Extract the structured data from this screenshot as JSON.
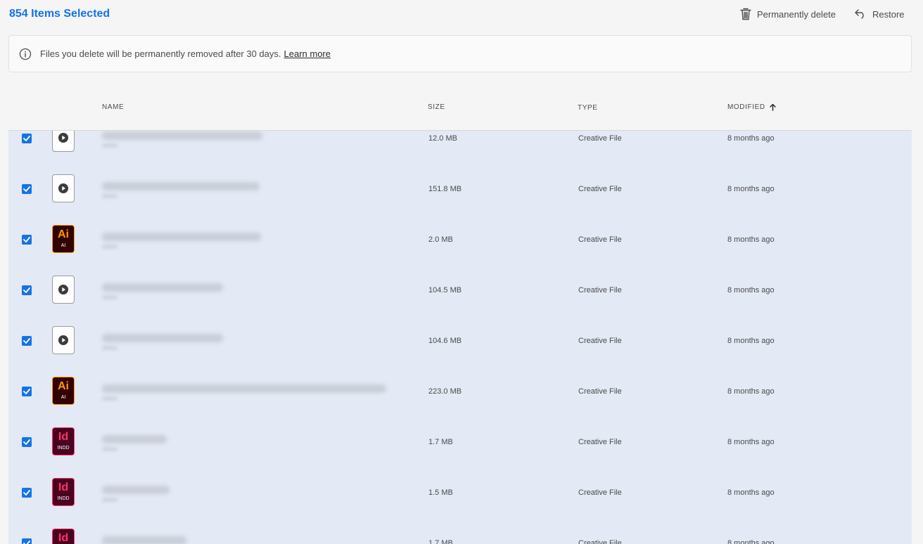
{
  "header": {
    "selection_title": "854 Items Selected",
    "permanently_delete_label": "Permanently delete",
    "restore_label": "Restore",
    "delete_icon": "trash-icon",
    "restore_icon": "undo-icon"
  },
  "banner": {
    "icon": "info-icon",
    "message": "Files you delete will be permanently removed after 30 days.",
    "link_label": "Learn more"
  },
  "table": {
    "columns": {
      "name": "NAME",
      "size": "SIZE",
      "type": "TYPE",
      "modified": "MODIFIED"
    },
    "sort": {
      "column": "modified",
      "direction": "ascending",
      "icon": "arrow-up-icon"
    },
    "rows": [
      {
        "selected": true,
        "icon": "video",
        "size": "12.0 MB",
        "type": "Creative File",
        "modified": "8 months ago"
      },
      {
        "selected": true,
        "icon": "video",
        "size": "151.8 MB",
        "type": "Creative File",
        "modified": "8 months ago"
      },
      {
        "selected": true,
        "icon": "ai",
        "icon_text": "Ai",
        "icon_subtext": "AI",
        "size": "2.0 MB",
        "type": "Creative File",
        "modified": "8 months ago"
      },
      {
        "selected": true,
        "icon": "video",
        "size": "104.5 MB",
        "type": "Creative File",
        "modified": "8 months ago"
      },
      {
        "selected": true,
        "icon": "video",
        "size": "104.6 MB",
        "type": "Creative File",
        "modified": "8 months ago"
      },
      {
        "selected": true,
        "icon": "ai",
        "icon_text": "Ai",
        "icon_subtext": "AI",
        "size": "223.0 MB",
        "type": "Creative File",
        "modified": "8 months ago"
      },
      {
        "selected": true,
        "icon": "id",
        "icon_text": "Id",
        "icon_subtext": "INDD",
        "size": "1.7 MB",
        "type": "Creative File",
        "modified": "8 months ago"
      },
      {
        "selected": true,
        "icon": "id",
        "icon_text": "Id",
        "icon_subtext": "INDD",
        "size": "1.5 MB",
        "type": "Creative File",
        "modified": "8 months ago"
      },
      {
        "selected": true,
        "icon": "id",
        "icon_text": "Id",
        "icon_subtext": "INDD",
        "size": "1.7 MB",
        "type": "Creative File",
        "modified": "8 months ago"
      }
    ]
  },
  "colors": {
    "accent": "#1473e6",
    "selected_row": "#e3e9f5",
    "illustrator_orange": "#ff9a00",
    "indesign_pink": "#ff3366"
  }
}
